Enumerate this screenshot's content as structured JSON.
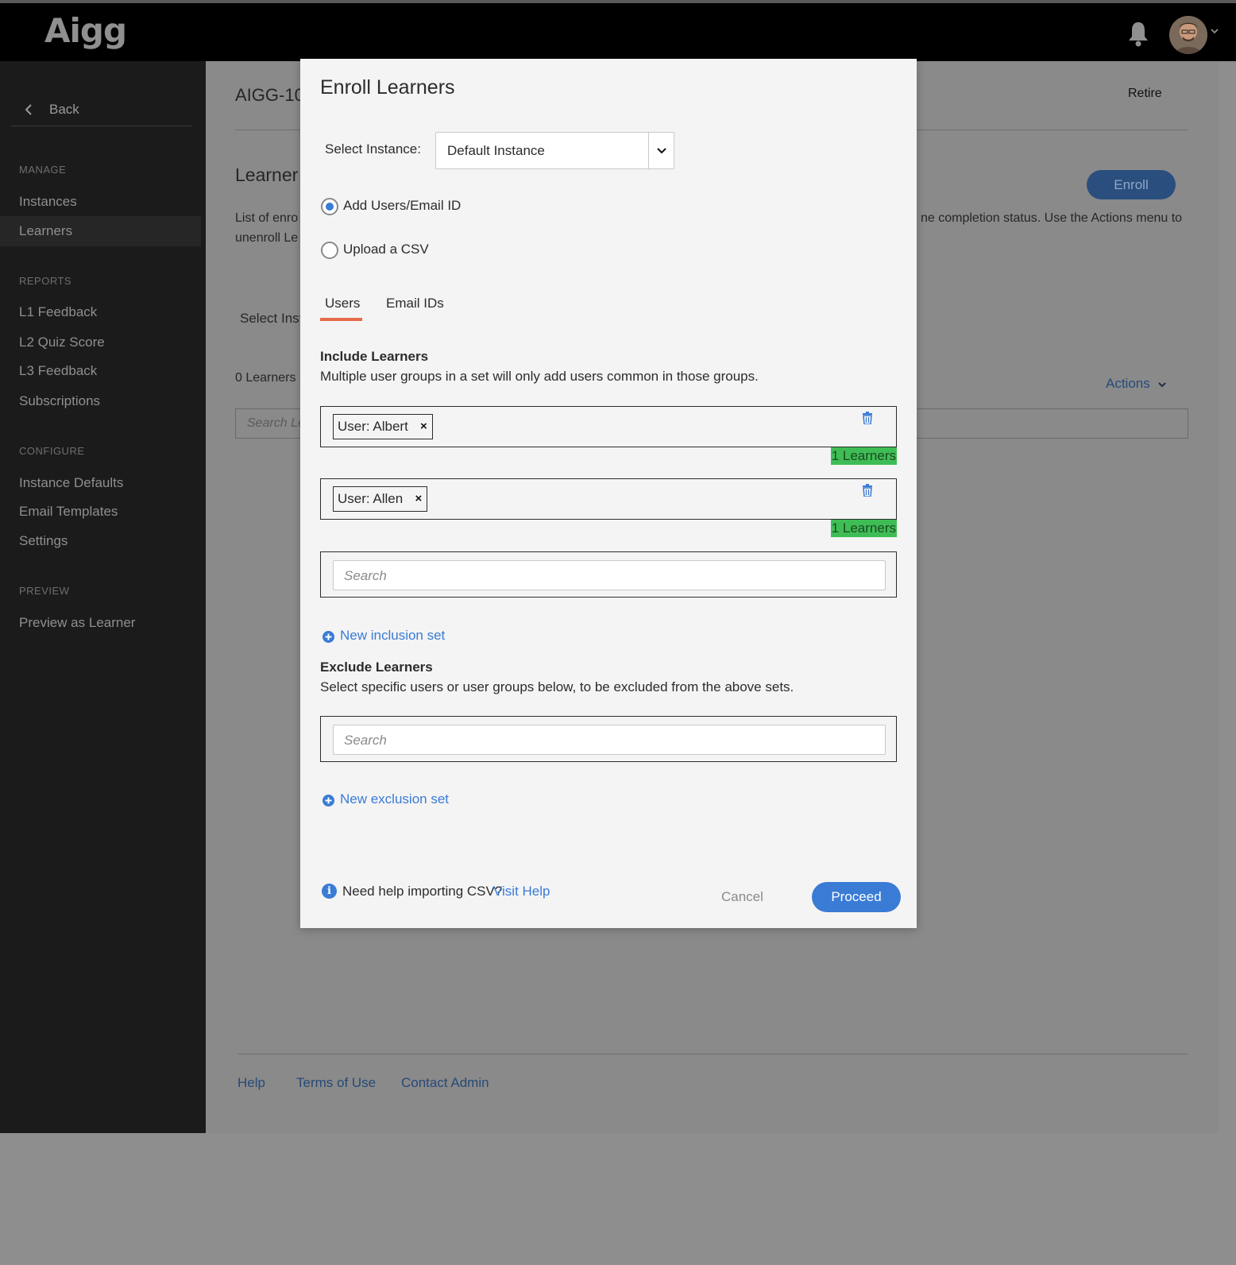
{
  "topbar": {
    "logo": "Aigg",
    "bell_icon": "bell-icon",
    "avatar_icon": "avatar"
  },
  "sidebar": {
    "back_label": "Back",
    "sections": [
      {
        "title": "MANAGE",
        "items": [
          "Instances",
          "Learners"
        ]
      },
      {
        "title": "REPORTS",
        "items": [
          "L1 Feedback",
          "L2 Quiz Score",
          "L3 Feedback",
          "Subscriptions"
        ]
      },
      {
        "title": "CONFIGURE",
        "items": [
          "Instance Defaults",
          "Email Templates",
          "Settings"
        ]
      },
      {
        "title": "PREVIEW",
        "items": [
          "Preview as Learner"
        ]
      }
    ],
    "active_item": "Learners"
  },
  "background": {
    "title": "AIGG-10",
    "retire_label": "Retire",
    "learners_heading": "Learner",
    "enroll_label": "Enroll",
    "desc_line1_start": "List of enro",
    "desc_line1_end": "ne completion status. Use the Actions menu to",
    "desc_line2": "unenroll Le",
    "select_instance": "Select Inst",
    "learner_count": "0 Learners",
    "actions_label": "Actions",
    "search_placeholder": "Search Le",
    "footer_links": [
      "Help",
      "Terms of Use",
      "Contact Admin"
    ]
  },
  "modal": {
    "title": "Enroll Learners",
    "select_instance_label": "Select Instance:",
    "select_instance_value": "Default Instance",
    "radios": [
      {
        "label": "Add Users/Email ID",
        "checked": true
      },
      {
        "label": "Upload a CSV",
        "checked": false
      }
    ],
    "tabs": [
      {
        "label": "Users",
        "active": true
      },
      {
        "label": "Email IDs",
        "active": false
      }
    ],
    "include": {
      "heading": "Include Learners",
      "description": "Multiple user groups in a set will only add users common in those groups.",
      "sets": [
        {
          "chip": "User: Albert",
          "count": "1 Learners"
        },
        {
          "chip": "User: Allen",
          "count": "1 Learners"
        }
      ],
      "search_placeholder": "Search",
      "add_label": "New inclusion set"
    },
    "exclude": {
      "heading": "Exclude Learners",
      "description": "Select specific users or user groups below, to be excluded from the above sets.",
      "search_placeholder": "Search",
      "add_label": "New exclusion set"
    },
    "help_text": "Need help importing CSV?",
    "help_link": "Visit Help",
    "cancel_label": "Cancel",
    "proceed_label": "Proceed"
  },
  "colors": {
    "accent": "#3a7bd5",
    "tab_underline": "#e66a4a",
    "count_badge": "#3fbd55"
  }
}
